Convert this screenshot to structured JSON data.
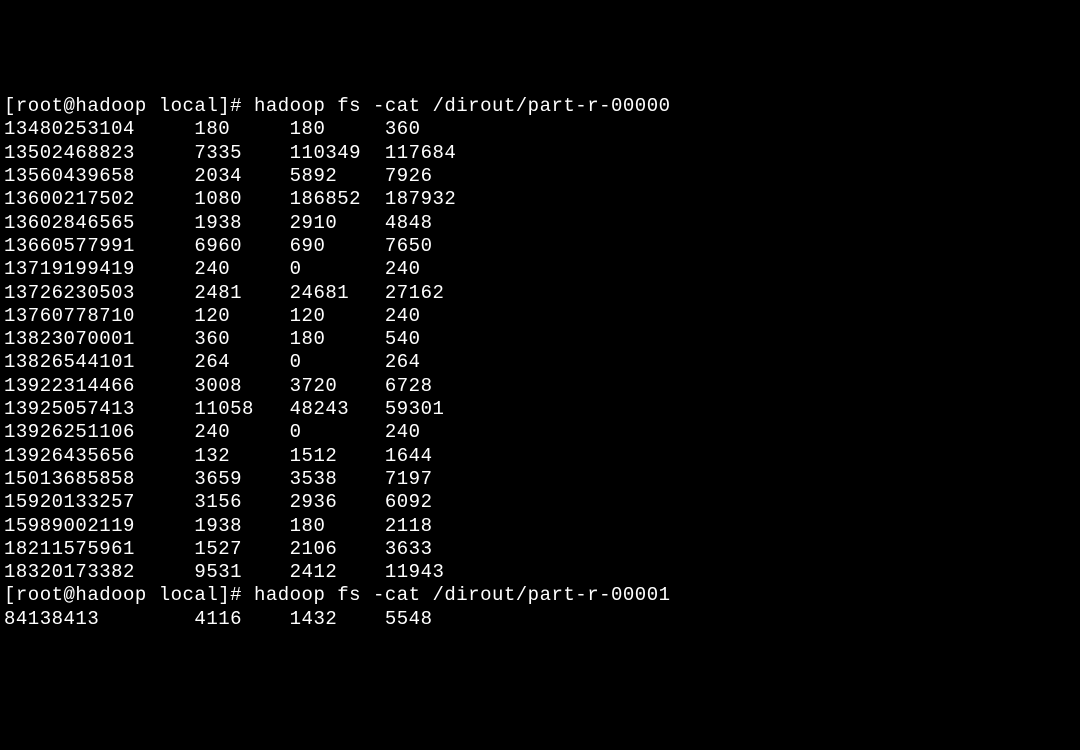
{
  "prompt1": {
    "user": "root",
    "host": "hadoop",
    "dir": "local",
    "command": "hadoop fs -cat /dirout/part-r-00000"
  },
  "data1": [
    {
      "c0": "13480253104",
      "c1": "180",
      "c2": "180",
      "c3": "360"
    },
    {
      "c0": "13502468823",
      "c1": "7335",
      "c2": "110349",
      "c3": "117684"
    },
    {
      "c0": "13560439658",
      "c1": "2034",
      "c2": "5892",
      "c3": "7926"
    },
    {
      "c0": "13600217502",
      "c1": "1080",
      "c2": "186852",
      "c3": "187932"
    },
    {
      "c0": "13602846565",
      "c1": "1938",
      "c2": "2910",
      "c3": "4848"
    },
    {
      "c0": "13660577991",
      "c1": "6960",
      "c2": "690",
      "c3": "7650"
    },
    {
      "c0": "13719199419",
      "c1": "240",
      "c2": "0",
      "c3": "240"
    },
    {
      "c0": "13726230503",
      "c1": "2481",
      "c2": "24681",
      "c3": "27162"
    },
    {
      "c0": "13760778710",
      "c1": "120",
      "c2": "120",
      "c3": "240"
    },
    {
      "c0": "13823070001",
      "c1": "360",
      "c2": "180",
      "c3": "540"
    },
    {
      "c0": "13826544101",
      "c1": "264",
      "c2": "0",
      "c3": "264"
    },
    {
      "c0": "13922314466",
      "c1": "3008",
      "c2": "3720",
      "c3": "6728"
    },
    {
      "c0": "13925057413",
      "c1": "11058",
      "c2": "48243",
      "c3": "59301"
    },
    {
      "c0": "13926251106",
      "c1": "240",
      "c2": "0",
      "c3": "240"
    },
    {
      "c0": "13926435656",
      "c1": "132",
      "c2": "1512",
      "c3": "1644"
    },
    {
      "c0": "15013685858",
      "c1": "3659",
      "c2": "3538",
      "c3": "7197"
    },
    {
      "c0": "15920133257",
      "c1": "3156",
      "c2": "2936",
      "c3": "6092"
    },
    {
      "c0": "15989002119",
      "c1": "1938",
      "c2": "180",
      "c3": "2118"
    },
    {
      "c0": "18211575961",
      "c1": "1527",
      "c2": "2106",
      "c3": "3633"
    },
    {
      "c0": "18320173382",
      "c1": "9531",
      "c2": "2412",
      "c3": "11943"
    }
  ],
  "prompt2": {
    "user": "root",
    "host": "hadoop",
    "dir": "local",
    "command": "hadoop fs -cat /dirout/part-r-00001"
  },
  "data2": [
    {
      "c0": "84138413",
      "c1": "4116",
      "c2": "1432",
      "c3": "5548"
    }
  ]
}
